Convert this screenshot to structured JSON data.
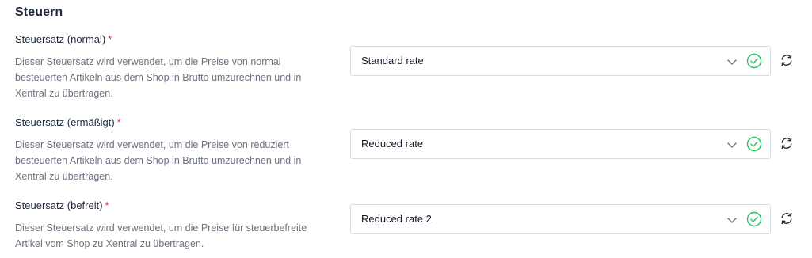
{
  "section": {
    "title": "Steuern"
  },
  "fields": [
    {
      "label": "Steuersatz (normal)",
      "required_mark": "*",
      "description": "Dieser Steuersatz wird verwendet, um die Preise von normal besteuerten Artikeln aus dem Shop in Brutto umzurechnen und in Xentral zu übertragen.",
      "value": "Standard rate"
    },
    {
      "label": "Steuersatz (ermäßigt)",
      "required_mark": "*",
      "description": "Dieser Steuersatz wird verwendet, um die Preise von reduziert besteuerten Artikeln aus dem Shop in Brutto umzurechnen und in Xentral zu übertragen.",
      "value": "Reduced rate"
    },
    {
      "label": "Steuersatz (befreit)",
      "required_mark": "*",
      "description": "Dieser Steuersatz wird verwendet, um die Preise für steuerbefreite Artikel vom Shop zu Xentral zu übertragen.",
      "value": "Reduced rate 2"
    }
  ],
  "icons": {
    "dropdown": "chevron-down-icon",
    "valid": "check-circle-icon",
    "refresh": "refresh-icon"
  },
  "colors": {
    "required": "#e11d48",
    "valid": "#22c55e",
    "description": "#6b7280"
  }
}
